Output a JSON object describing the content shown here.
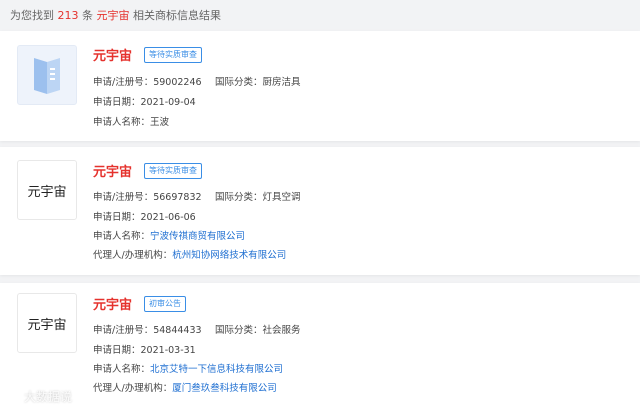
{
  "summary": {
    "prefix": "为您找到",
    "count": "213",
    "mid": "条",
    "keyword": "元宇宙",
    "suffix": "相关商标信息结果"
  },
  "results": [
    {
      "name": "元宇宙",
      "status": "等待实质审查",
      "logo_text": "",
      "logo_icon": "book-cover-image",
      "reg_label": "申请/注册号：",
      "reg_no": "59002246",
      "class_label": "国际分类：",
      "class_value": "厨房洁具",
      "date_label": "申请日期：",
      "date": "2021-09-04",
      "applicant_label": "申请人名称：",
      "applicant": "王波"
    },
    {
      "name": "元宇宙",
      "status": "等待实质审查",
      "logo_text": "元宇宙",
      "reg_label": "申请/注册号：",
      "reg_no": "56697832",
      "class_label": "国际分类：",
      "class_value": "灯具空调",
      "date_label": "申请日期：",
      "date": "2021-06-06",
      "applicant_label": "申请人名称：",
      "applicant": "宁波传祺商贸有限公司",
      "agent_label": "代理人/办理机构：",
      "agent": "杭州知协网络技术有限公司"
    },
    {
      "name": "元宇宙",
      "status": "初审公告",
      "logo_text": "元宇宙",
      "reg_label": "申请/注册号：",
      "reg_no": "54844433",
      "class_label": "国际分类：",
      "class_value": "社会服务",
      "date_label": "申请日期：",
      "date": "2021-03-31",
      "applicant_label": "申请人名称：",
      "applicant": "北京艾特一下信息科技有限公司",
      "agent_label": "代理人/办理机构：",
      "agent": "厦门叁玖叁科技有限公司"
    }
  ],
  "watermark": "大数据说",
  "colors": {
    "accent_red": "#e5322d",
    "link_blue": "#1f6fd1",
    "tag_blue": "#3a8ee6"
  }
}
